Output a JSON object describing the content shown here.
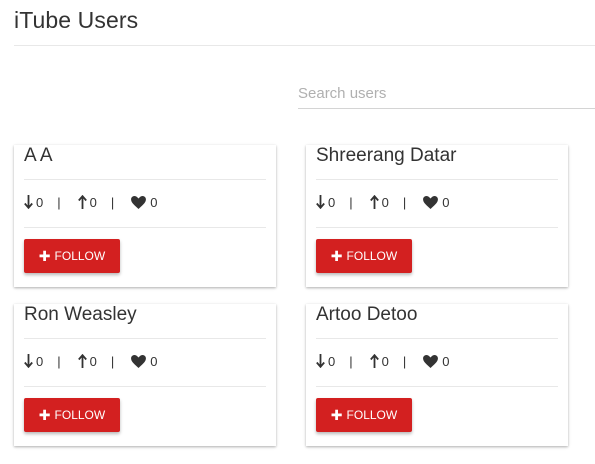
{
  "page": {
    "title": "iTube Users"
  },
  "search": {
    "placeholder": "Search users",
    "value": ""
  },
  "users": [
    {
      "name": "A A",
      "downloads": "0",
      "uploads": "0",
      "likes": "0",
      "button_label": "FOLLOW"
    },
    {
      "name": "Shreerang Datar",
      "downloads": "0",
      "uploads": "0",
      "likes": "0",
      "button_label": "FOLLOW"
    },
    {
      "name": "Ron Weasley",
      "downloads": "0",
      "uploads": "0",
      "likes": "0",
      "button_label": "FOLLOW"
    },
    {
      "name": "Artoo Detoo",
      "downloads": "0",
      "uploads": "0",
      "likes": "0",
      "button_label": "FOLLOW"
    }
  ],
  "separator": "|",
  "icons": {
    "down": "arrow-down-icon",
    "up": "arrow-up-icon",
    "heart": "heart-icon",
    "plus": "plus-icon"
  },
  "colors": {
    "accent": "#d32020",
    "text": "#333333",
    "placeholder": "#b0b0b0"
  }
}
